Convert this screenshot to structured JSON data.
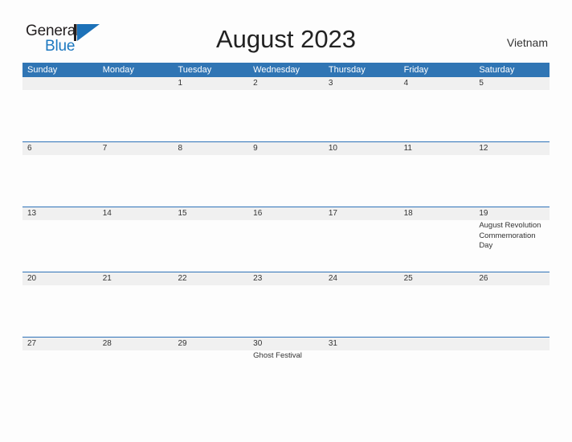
{
  "brand": {
    "name_part1": "General",
    "name_part2": "Blue",
    "logo_icon": "flag-triangle-icon"
  },
  "header": {
    "title": "August 2023",
    "country": "Vietnam"
  },
  "calendar": {
    "weekday_headers": [
      "Sunday",
      "Monday",
      "Tuesday",
      "Wednesday",
      "Thursday",
      "Friday",
      "Saturday"
    ],
    "colors": {
      "header_blue": "#3075b4",
      "divider_blue": "#2e72b8",
      "daynum_band": "#f0f0f0",
      "page_background": "#fdfdfd",
      "brand_blue": "#1c78c0",
      "text": "#333333"
    },
    "weeks": [
      {
        "days": [
          {
            "num": "",
            "event": ""
          },
          {
            "num": "",
            "event": ""
          },
          {
            "num": "1",
            "event": ""
          },
          {
            "num": "2",
            "event": ""
          },
          {
            "num": "3",
            "event": ""
          },
          {
            "num": "4",
            "event": ""
          },
          {
            "num": "5",
            "event": ""
          }
        ]
      },
      {
        "days": [
          {
            "num": "6",
            "event": ""
          },
          {
            "num": "7",
            "event": ""
          },
          {
            "num": "8",
            "event": ""
          },
          {
            "num": "9",
            "event": ""
          },
          {
            "num": "10",
            "event": ""
          },
          {
            "num": "11",
            "event": ""
          },
          {
            "num": "12",
            "event": ""
          }
        ]
      },
      {
        "days": [
          {
            "num": "13",
            "event": ""
          },
          {
            "num": "14",
            "event": ""
          },
          {
            "num": "15",
            "event": ""
          },
          {
            "num": "16",
            "event": ""
          },
          {
            "num": "17",
            "event": ""
          },
          {
            "num": "18",
            "event": ""
          },
          {
            "num": "19",
            "event": "August Revolution Commemoration Day"
          }
        ]
      },
      {
        "days": [
          {
            "num": "20",
            "event": ""
          },
          {
            "num": "21",
            "event": ""
          },
          {
            "num": "22",
            "event": ""
          },
          {
            "num": "23",
            "event": ""
          },
          {
            "num": "24",
            "event": ""
          },
          {
            "num": "25",
            "event": ""
          },
          {
            "num": "26",
            "event": ""
          }
        ]
      },
      {
        "days": [
          {
            "num": "27",
            "event": ""
          },
          {
            "num": "28",
            "event": ""
          },
          {
            "num": "29",
            "event": ""
          },
          {
            "num": "30",
            "event": "Ghost Festival"
          },
          {
            "num": "31",
            "event": ""
          },
          {
            "num": "",
            "event": ""
          },
          {
            "num": "",
            "event": ""
          }
        ]
      }
    ]
  }
}
